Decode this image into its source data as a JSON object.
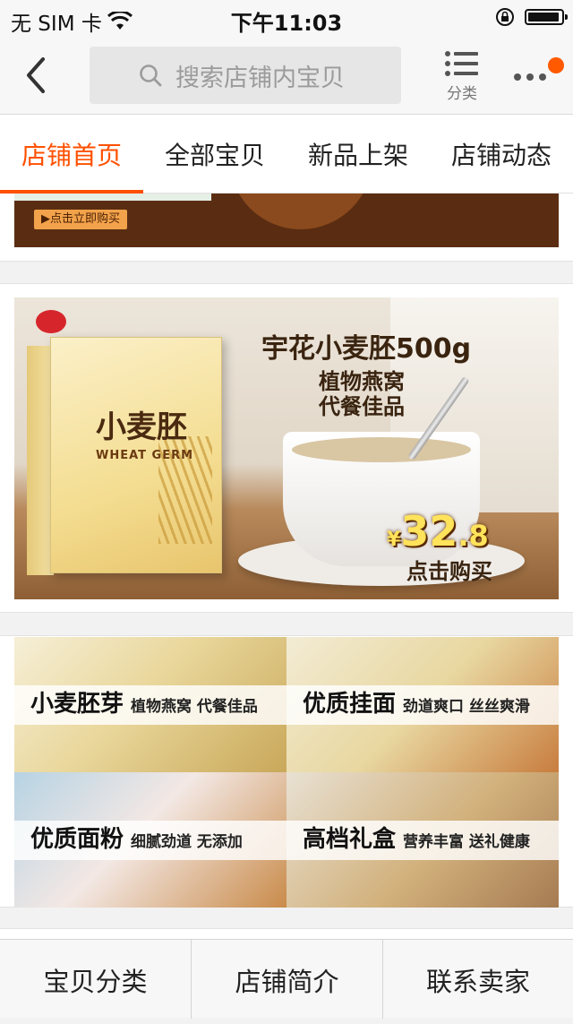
{
  "status_bar": {
    "carrier": "无 SIM 卡",
    "time": "下午11:03"
  },
  "nav": {
    "search_placeholder": "搜索店铺内宝贝",
    "category_label": "分类"
  },
  "tabs": [
    {
      "label": "店铺首页",
      "active": true
    },
    {
      "label": "全部宝贝",
      "active": false
    },
    {
      "label": "新品上架",
      "active": false
    },
    {
      "label": "店铺动态",
      "active": false
    }
  ],
  "banner_top": {
    "cta": "▶点击立即购买"
  },
  "banner_main": {
    "title": "宇花小麦胚500g",
    "subtitle_1": "植物燕窝",
    "subtitle_2": "代餐佳品",
    "product_name": "小麦胚",
    "product_en": "WHEAT GERM",
    "price_symbol": "¥",
    "price_int": "32",
    "price_dec": ".8",
    "cta": "点击购买"
  },
  "categories": [
    {
      "title": "小麦胚芽",
      "desc": "植物燕窝 代餐佳品",
      "color": "#c9a85a"
    },
    {
      "title": "优质挂面",
      "desc": "劲道爽口 丝丝爽滑",
      "color": "#e8d7a0"
    },
    {
      "title": "优质面粉",
      "desc": "细腻劲道  无添加",
      "color": "#f3e8e4"
    },
    {
      "title": "高档礼盒",
      "desc": "营养丰富 送礼健康",
      "color": "#a67b52"
    }
  ],
  "bottom_bar": [
    {
      "label": "宝贝分类"
    },
    {
      "label": "店铺简介"
    },
    {
      "label": "联系卖家"
    }
  ],
  "colors": {
    "accent": "#ff5000",
    "badge": "#ff5a00"
  }
}
